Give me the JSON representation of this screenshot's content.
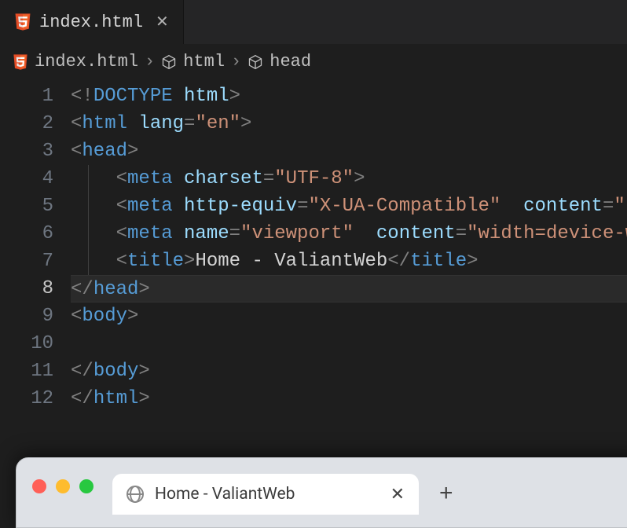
{
  "editor": {
    "tab": {
      "filename": "index.html",
      "close_glyph": "✕"
    },
    "breadcrumb": [
      {
        "kind": "file",
        "label": "index.html"
      },
      {
        "kind": "element",
        "label": "html"
      },
      {
        "kind": "element",
        "label": "head"
      }
    ],
    "breadcrumb_sep": "›",
    "active_line": 8,
    "lines": [
      {
        "n": 1,
        "indent": 0,
        "tokens": [
          {
            "t": "punc",
            "v": "<!"
          },
          {
            "t": "doctype",
            "v": "DOCTYPE"
          },
          {
            "t": "text",
            "v": " "
          },
          {
            "t": "attr",
            "v": "html"
          },
          {
            "t": "punc",
            "v": ">"
          }
        ]
      },
      {
        "n": 2,
        "indent": 0,
        "tokens": [
          {
            "t": "punc",
            "v": "<"
          },
          {
            "t": "tag",
            "v": "html"
          },
          {
            "t": "text",
            "v": " "
          },
          {
            "t": "attr",
            "v": "lang"
          },
          {
            "t": "punc",
            "v": "="
          },
          {
            "t": "str",
            "v": "\"en\""
          },
          {
            "t": "punc",
            "v": ">"
          }
        ]
      },
      {
        "n": 3,
        "indent": 0,
        "tokens": [
          {
            "t": "punc",
            "v": "<"
          },
          {
            "t": "tag",
            "v": "head"
          },
          {
            "t": "punc",
            "v": ">"
          }
        ]
      },
      {
        "n": 4,
        "indent": 1,
        "guide": true,
        "tokens": [
          {
            "t": "punc",
            "v": "<"
          },
          {
            "t": "tag",
            "v": "meta"
          },
          {
            "t": "text",
            "v": " "
          },
          {
            "t": "attr",
            "v": "charset"
          },
          {
            "t": "punc",
            "v": "="
          },
          {
            "t": "str",
            "v": "\"UTF-8\""
          },
          {
            "t": "punc",
            "v": ">"
          }
        ]
      },
      {
        "n": 5,
        "indent": 1,
        "guide": true,
        "tokens": [
          {
            "t": "punc",
            "v": "<"
          },
          {
            "t": "tag",
            "v": "meta"
          },
          {
            "t": "text",
            "v": " "
          },
          {
            "t": "attr",
            "v": "http-equiv"
          },
          {
            "t": "punc",
            "v": "="
          },
          {
            "t": "str",
            "v": "\"X-UA-Compatible\""
          },
          {
            "t": "text",
            "v": "  "
          },
          {
            "t": "attr",
            "v": "content"
          },
          {
            "t": "punc",
            "v": "="
          },
          {
            "t": "str",
            "v": "\"I"
          }
        ]
      },
      {
        "n": 6,
        "indent": 1,
        "guide": true,
        "tokens": [
          {
            "t": "punc",
            "v": "<"
          },
          {
            "t": "tag",
            "v": "meta"
          },
          {
            "t": "text",
            "v": " "
          },
          {
            "t": "attr",
            "v": "name"
          },
          {
            "t": "punc",
            "v": "="
          },
          {
            "t": "str",
            "v": "\"viewport\""
          },
          {
            "t": "text",
            "v": "  "
          },
          {
            "t": "attr",
            "v": "content"
          },
          {
            "t": "punc",
            "v": "="
          },
          {
            "t": "str",
            "v": "\"width=device-w"
          }
        ]
      },
      {
        "n": 7,
        "indent": 1,
        "guide": true,
        "tokens": [
          {
            "t": "punc",
            "v": "<"
          },
          {
            "t": "tag",
            "v": "title"
          },
          {
            "t": "punc",
            "v": ">"
          },
          {
            "t": "text",
            "v": "Home - ValiantWeb"
          },
          {
            "t": "punc",
            "v": "</"
          },
          {
            "t": "tag",
            "v": "title"
          },
          {
            "t": "punc",
            "v": ">"
          }
        ]
      },
      {
        "n": 8,
        "indent": 0,
        "tokens": [
          {
            "t": "punc",
            "v": "</"
          },
          {
            "t": "tag",
            "v": "head"
          },
          {
            "t": "punc",
            "v": ">"
          }
        ]
      },
      {
        "n": 9,
        "indent": 0,
        "tokens": [
          {
            "t": "punc",
            "v": "<"
          },
          {
            "t": "tag",
            "v": "body"
          },
          {
            "t": "punc",
            "v": ">"
          }
        ]
      },
      {
        "n": 10,
        "indent": 0,
        "tokens": []
      },
      {
        "n": 11,
        "indent": 0,
        "tokens": [
          {
            "t": "punc",
            "v": "</"
          },
          {
            "t": "tag",
            "v": "body"
          },
          {
            "t": "punc",
            "v": ">"
          }
        ]
      },
      {
        "n": 12,
        "indent": 0,
        "tokens": [
          {
            "t": "punc",
            "v": "</"
          },
          {
            "t": "tag",
            "v": "html"
          },
          {
            "t": "punc",
            "v": ">"
          }
        ]
      }
    ]
  },
  "browser": {
    "tab_title": "Home - ValiantWeb",
    "close_glyph": "✕",
    "new_tab_glyph": "+"
  }
}
